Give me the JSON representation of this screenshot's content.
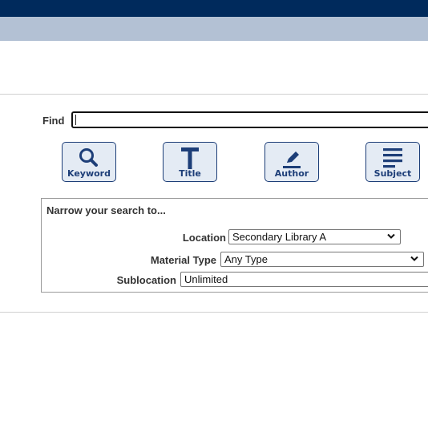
{
  "colors": {
    "header": "#002a5c",
    "subheader": "#b3c1d4",
    "button_accent": "#1d3e78",
    "button_bg": "#e4ebf4"
  },
  "search": {
    "find_label": "Find",
    "find_value": ""
  },
  "buttons": [
    {
      "label": "Keyword",
      "icon": "magnifier-icon"
    },
    {
      "label": "Title",
      "icon": "letter-t-icon"
    },
    {
      "label": "Author",
      "icon": "pencil-icon"
    },
    {
      "label": "Subject",
      "icon": "lines-icon"
    }
  ],
  "narrow": {
    "title": "Narrow your search to...",
    "location_label": "Location",
    "location_value": "Secondary Library A",
    "material_label": "Material Type",
    "material_value": "Any Type",
    "sublocation_label": "Sublocation",
    "sublocation_value": "Unlimited"
  }
}
